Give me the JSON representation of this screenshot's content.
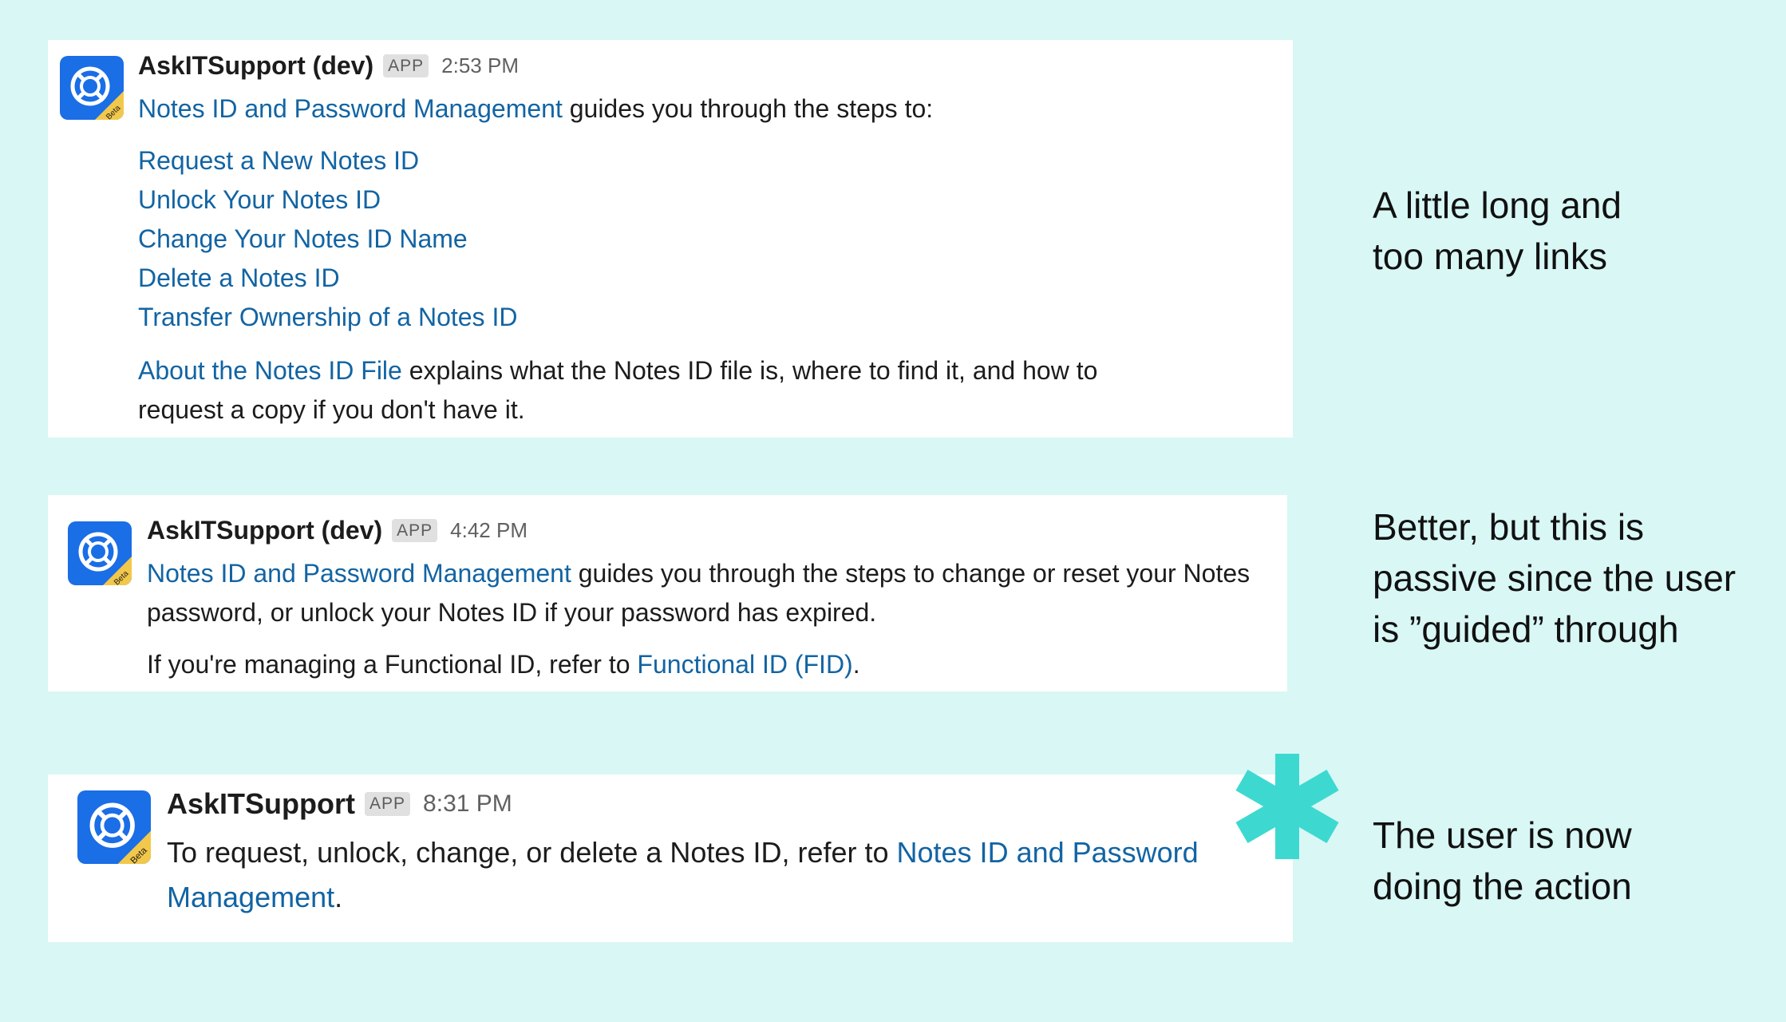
{
  "messages": [
    {
      "sender": "AskITSupport (dev)",
      "badge": "APP",
      "time": "2:53 PM",
      "avatar_label": "Beta",
      "intro_link": "Notes ID and Password Management",
      "intro_text": " guides you through the steps to:",
      "links": [
        "Request a New Notes ID",
        "Unlock Your Notes ID",
        "Change Your Notes ID Name",
        "Delete a Notes ID",
        "Transfer Ownership of a Notes ID"
      ],
      "footer_link": "About the Notes ID File",
      "footer_text": " explains what the Notes ID file is, where to find it, and how to request a copy if you don't have it."
    },
    {
      "sender": "AskITSupport (dev)",
      "badge": "APP",
      "time": "4:42 PM",
      "avatar_label": "Beta",
      "intro_link": "Notes ID and Password Management",
      "intro_text": " guides you through the steps to change or reset your Notes password, or unlock your Notes ID if your password has expired.",
      "fid_prefix": "If you're managing a Functional ID, refer to ",
      "fid_link": "Functional ID (FID)",
      "fid_suffix": "."
    },
    {
      "sender": "AskITSupport",
      "badge": "APP",
      "time": "8:31 PM",
      "avatar_label": "Beta",
      "text_prefix": "To request, unlock, change, or delete a Notes ID, refer to ",
      "link": "Notes ID and Password Management",
      "text_suffix": "."
    }
  ],
  "notes": [
    "A little long and too many links",
    "Better, but this is passive since the user is ”guided” through",
    "The user is now doing the action"
  ],
  "colors": {
    "background": "#d8f7f5",
    "link": "#1264a3",
    "avatar": "#1a6ee6",
    "beta_ribbon": "#f2c84b",
    "asterisk": "#3dd9d0"
  },
  "icons": {
    "avatar": "lifebuoy-icon",
    "highlight": "asterisk-icon"
  }
}
